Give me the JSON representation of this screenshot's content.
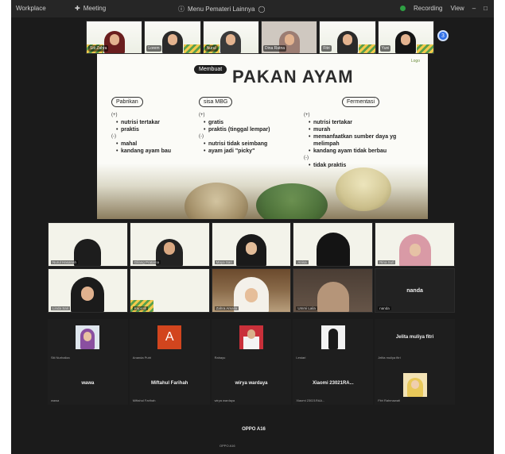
{
  "topbar": {
    "app_name": "Workplace",
    "meeting_label": "Meeting",
    "middle_text": "Menu Pemateri Lainnya",
    "status_text": "Recording",
    "view_label": "View"
  },
  "strip": {
    "tiles": [
      {
        "name": "Siti Zahra"
      },
      {
        "name": "Lorem"
      },
      {
        "name": "Nurul"
      },
      {
        "name": "Dina Ratna"
      },
      {
        "name": "Fitri"
      },
      {
        "name": "Yuni"
      }
    ],
    "next_count": "3"
  },
  "slide": {
    "badge": "Membuat",
    "title": "PAKAN AYAM",
    "logo_text": "Logo",
    "col1": {
      "header": "Pabrikan",
      "plus": "(+)",
      "plus_items": [
        "nutrisi tertakar",
        "praktis"
      ],
      "minus": "(-)",
      "minus_items": [
        "mahal",
        "kandang ayam bau"
      ]
    },
    "col2": {
      "header": "sisa MBG",
      "plus": "(+)",
      "plus_items": [
        "gratis",
        "praktis (tinggal lempar)"
      ],
      "minus": "(-)",
      "minus_items": [
        "nutrisi tidak seimbang",
        "ayam jadi \"picky\""
      ]
    },
    "col3": {
      "header": "Fermentasi",
      "plus": "(+)",
      "plus_items": [
        "nutrisi tertakar",
        "murah",
        "memanfaatkan sumber daya yg melimpah",
        "kandang ayam tidak berbau"
      ],
      "minus": "(-)",
      "minus_items": [
        "tidak praktis"
      ]
    }
  },
  "gallery": {
    "row1": [
      "Nurul",
      "Gilang",
      "Maya",
      "Anisa",
      "Rina"
    ],
    "row2": [
      "Linda",
      "",
      "Zahra",
      "Ummi",
      "nanda"
    ],
    "row2_center_name": "nanda",
    "small_labels": [
      "Nurul Hasanah",
      "Gilang Pratama",
      "Maya Sari",
      "Anisa",
      "Rina Sufi",
      "Linda Sari",
      "Kaprodi",
      "Zahra Amalia",
      "Ummi Laila",
      "nanda"
    ]
  },
  "names": {
    "row1": [
      {
        "display": "",
        "small": "Siti Nurhaliza",
        "type": "photo"
      },
      {
        "display": "A",
        "small": "Ananda Putri",
        "type": "letter"
      },
      {
        "display": "",
        "small": "Rahayu",
        "type": "photo2"
      },
      {
        "display": "",
        "small": "Lestari",
        "type": "photo3"
      },
      {
        "display": "Jelita muliya fitri",
        "small": "Jelita muliya fitri",
        "type": "name"
      }
    ],
    "row2": [
      {
        "display": "wawa",
        "small": "wawa",
        "type": "name"
      },
      {
        "display": "Miftahul Farihah",
        "small": "Miftahul Farihah",
        "type": "name"
      },
      {
        "display": "wirya wardaya",
        "small": "wirya wardaya",
        "type": "name"
      },
      {
        "display": "Xiaomi 23021RA...",
        "small": "Xiaomi 23021RAA...",
        "type": "name"
      },
      {
        "display": "",
        "small": "Fitri Rahmawati",
        "type": "photo4"
      }
    ],
    "last": {
      "display": "OPPO A16",
      "small": "OPPO A16"
    }
  },
  "colors": {
    "accent": "#2f6fe8",
    "background": "#1b1b1b",
    "letter_avatar": "#d2451e"
  }
}
